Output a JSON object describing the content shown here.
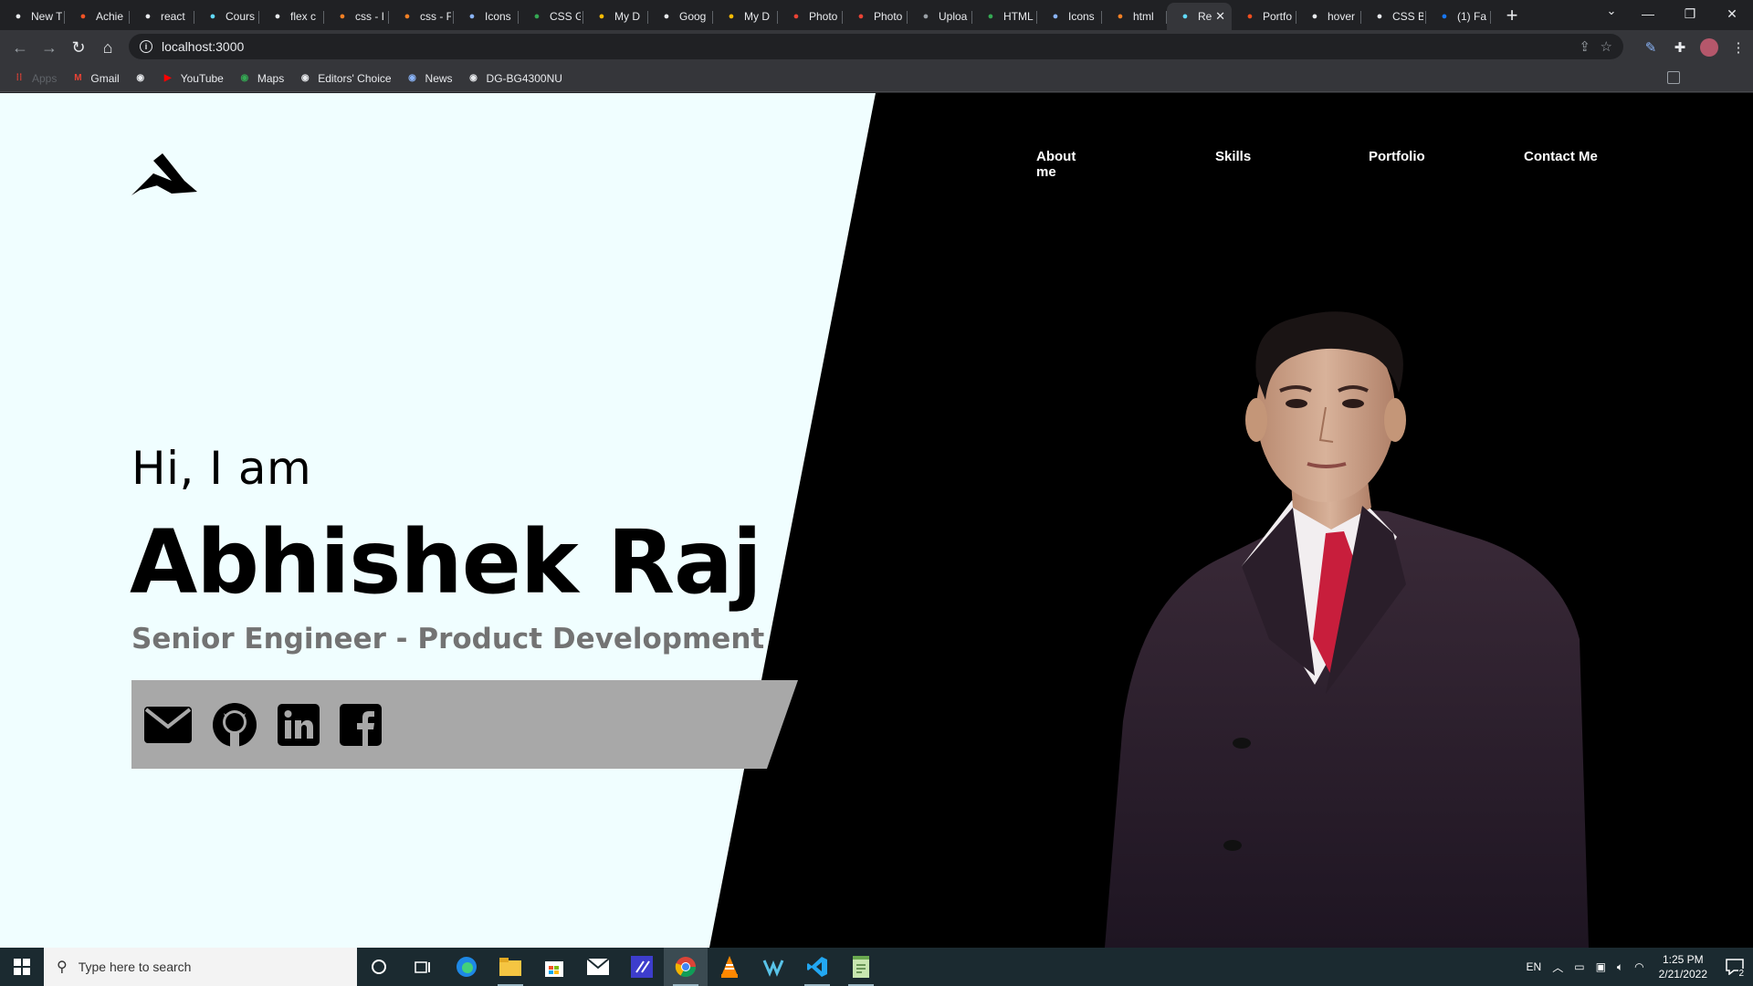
{
  "browser": {
    "tabs": [
      {
        "title": "New T",
        "icon": "chrome-icon",
        "color": "#e8eaed"
      },
      {
        "title": "Achie",
        "icon": "microsoft-icon",
        "color": "#f35325"
      },
      {
        "title": "react",
        "icon": "google-icon",
        "color": "#e8eaed"
      },
      {
        "title": "Cours",
        "icon": "react-icon",
        "color": "#61dafb"
      },
      {
        "title": "flex c",
        "icon": "google-icon",
        "color": "#e8eaed"
      },
      {
        "title": "css - I",
        "icon": "stackoverflow-icon",
        "color": "#f48024"
      },
      {
        "title": "css - F",
        "icon": "stackoverflow-icon",
        "color": "#f48024"
      },
      {
        "title": "Icons",
        "icon": "flag-icon",
        "color": "#8ab4f8"
      },
      {
        "title": "CSS G",
        "icon": "css-icon",
        "color": "#34a853"
      },
      {
        "title": "My D",
        "icon": "drive-icon",
        "color": "#fbbc04"
      },
      {
        "title": "Goog",
        "icon": "google-icon",
        "color": "#e8eaed"
      },
      {
        "title": "My D",
        "icon": "drive-icon",
        "color": "#fbbc04"
      },
      {
        "title": "Photo",
        "icon": "photos-icon",
        "color": "#ea4335"
      },
      {
        "title": "Photo",
        "icon": "photos-icon",
        "color": "#ea4335"
      },
      {
        "title": "Uploa",
        "icon": "layers-icon",
        "color": "#9aa0a6"
      },
      {
        "title": "HTML",
        "icon": "w3-icon",
        "color": "#34a853"
      },
      {
        "title": "Icons",
        "icon": "flag-icon",
        "color": "#8ab4f8"
      },
      {
        "title": "html",
        "icon": "stackoverflow-icon",
        "color": "#f48024"
      },
      {
        "title": "Re",
        "icon": "react-icon",
        "color": "#61dafb",
        "active": true
      },
      {
        "title": "Portfo",
        "icon": "figma-icon",
        "color": "#f24e1e"
      },
      {
        "title": "hover",
        "icon": "chrome-icon",
        "color": "#e8eaed"
      },
      {
        "title": "CSS B",
        "icon": "openai-icon",
        "color": "#e8eaed"
      },
      {
        "title": "(1) Fa",
        "icon": "facebook-icon",
        "color": "#1877f2"
      }
    ],
    "url": "localhost:3000",
    "bookmarks": [
      {
        "label": "Apps",
        "icon": "apps-grid-icon",
        "dim": true
      },
      {
        "label": "Gmail",
        "icon": "gmail-icon"
      },
      {
        "label": "",
        "icon": "globe-icon"
      },
      {
        "label": "YouTube",
        "icon": "youtube-icon"
      },
      {
        "label": "Maps",
        "icon": "maps-icon"
      },
      {
        "label": "Editors' Choice",
        "icon": "globe-icon"
      },
      {
        "label": "News",
        "icon": "news-icon"
      },
      {
        "label": "DG-BG4300NU",
        "icon": "globe-icon"
      }
    ]
  },
  "page": {
    "nav": [
      "About me",
      "Skills",
      "Portfolio",
      "Contact Me"
    ],
    "greeting": "Hi, I am",
    "name": "Abhishek Raj",
    "role": "Senior Engineer - Product Development",
    "social": [
      "envelope-icon",
      "github-icon",
      "linkedin-icon",
      "facebook-icon"
    ],
    "colors": {
      "light_bg": "#f0feff",
      "dark_bg": "#000000",
      "social_bar": "#a8a8a8",
      "role_text": "#737373"
    }
  },
  "taskbar": {
    "search_placeholder": "Type here to search",
    "language": "EN",
    "time": "1:25 PM",
    "date": "2/21/2022",
    "notification_count": "2"
  }
}
